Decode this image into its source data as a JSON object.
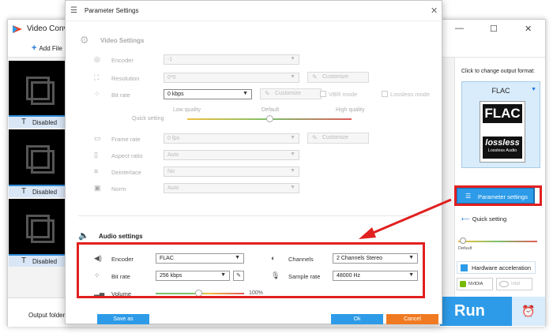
{
  "main_window": {
    "title": "Video Conv",
    "controls": {
      "minimize": "—",
      "maximize": "☐",
      "close": "✕"
    },
    "toolbar": {
      "add_files": "Add File"
    },
    "items": [
      {
        "status": "Disabled"
      },
      {
        "status": "Disabled"
      },
      {
        "status": "Disabled"
      }
    ],
    "output_folder_label": "Output folder:",
    "right_panel": {
      "click_change": "Click to change output format:",
      "format_name": "FLAC",
      "format_badge_top": "FLAC",
      "format_badge_big": "lossless",
      "format_badge_small": "Lossless Audio",
      "parameter_settings_label": "Parameter settings",
      "quick_setting_label": "Quick setting",
      "quick_default": "Default",
      "hw_accel_label": "Hardware acceleration",
      "gpu_nvidia": "NVIDIA",
      "gpu_intel": "Intel"
    },
    "run_label": "Run"
  },
  "dialog": {
    "title": "Parameter Settings",
    "close": "✕",
    "video_settings": {
      "heading": "Video Settings",
      "encoder": {
        "label": "Encoder",
        "value": "-1"
      },
      "resolution": {
        "label": "Resolution",
        "value": "0*0",
        "customize": "Customize"
      },
      "bit_rate": {
        "label": "Bit rate",
        "value": "0 kbps",
        "customize": "Customize",
        "vbr_mode": "VBR mode",
        "lossless_mode": "Lossless mode"
      },
      "quick_setting": {
        "label": "Quick setting",
        "low": "Low quality",
        "default": "Default",
        "high": "High quality"
      },
      "frame_rate": {
        "label": "Frame rate",
        "value": "0 fps",
        "customize": "Customize"
      },
      "aspect_ratio": {
        "label": "Aspect ratio",
        "value": "Auto"
      },
      "deinterlace": {
        "label": "Deinterlace",
        "value": "No"
      },
      "norm": {
        "label": "Norm",
        "value": "Auto"
      }
    },
    "audio_settings": {
      "heading": "Audio settings",
      "encoder": {
        "label": "Encoder",
        "value": "FLAC"
      },
      "channels": {
        "label": "Channels",
        "value": "2 Channels Stereo"
      },
      "bit_rate": {
        "label": "Bit rate",
        "value": "256 kbps"
      },
      "sample_rate": {
        "label": "Sample rate",
        "value": "48000 Hz"
      },
      "volume": {
        "label": "Volume",
        "value": "100%"
      }
    },
    "footer": {
      "save_as": "Save as",
      "ok": "Ok",
      "cancel": "Cancel"
    }
  },
  "colors": {
    "accent": "#2d9be8",
    "highlight": "#e12020",
    "cancel": "#f07a22"
  }
}
